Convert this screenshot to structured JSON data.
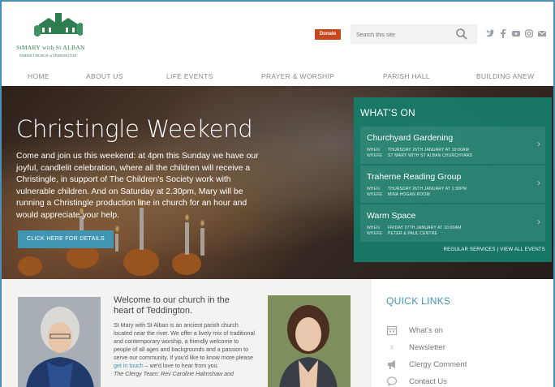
{
  "header": {
    "logo_name": "StMARY with St ALBAN",
    "logo_sub": "PARISH CHURCH of TEDDINGTON",
    "donate_label": "Donate",
    "search_placeholder": "Search this site"
  },
  "socials": [
    "twitter-icon",
    "facebook-icon",
    "youtube-icon",
    "instagram-icon",
    "email-icon"
  ],
  "nav": [
    "HOME",
    "ABOUT US",
    "LIFE EVENTS",
    "PRAYER & WORSHIP",
    "PARISH HALL",
    "BUILDING ANEW"
  ],
  "hero": {
    "title": "Christingle Weekend",
    "text": "Come and join us this weekend: at 4pm this Sunday we have our joyful, candlelit celebration, where all the children will receive a Christingle, in support of The Children's Society work with vulnerable children. And on Saturday at 2.30pm, Mary will be running a Christingle production line in church for an hour and would appreciate your help.",
    "button_label": "CLICK HERE FOR DETAILS"
  },
  "whats_on": {
    "title": "WHAT'S ON",
    "when_label": "WHEN",
    "where_label": "WHERE",
    "events": [
      {
        "title": "Churchyard Gardening",
        "when": "THURSDAY 26TH JANUARY AT 10:00AM",
        "where": "ST MARY WITH ST ALBAN CHURCHYARD"
      },
      {
        "title": "Traherne Reading Group",
        "when": "THURSDAY 26TH JANUARY AT 1:30PM",
        "where": "MINA HOGAN ROOM"
      },
      {
        "title": "Warm Space",
        "when": "FRIDAY 27TH JANUARY AT 10:00AM",
        "where": "PETER & PAUL CENTRE"
      }
    ],
    "links": "REGULAR SERVICES | VIEW ALL EVENTS"
  },
  "welcome": {
    "title": "Welcome to our church in the heart of Teddington.",
    "body": "St Mary with St Alban is an ancient parish church located near the river. We offer a lively mix of traditional and contemporary worship, a friendly welcome to people of all ages and backgrounds and a passion to serve our community. If you'd like to know more please",
    "link": "get in touch",
    "body_end": " – we'd love to hear from you.",
    "signature": "The Clergy Team: Rev Caroline Halmshaw and"
  },
  "quick_links": {
    "title": "QUICK LINKS",
    "items": [
      {
        "icon": "calendar-icon",
        "label": "What's on"
      },
      {
        "icon": "chevron-right-icon",
        "label": "Newsletter"
      },
      {
        "icon": "megaphone-icon",
        "label": "Clergy Comment"
      },
      {
        "icon": "chat-bubble-icon",
        "label": "Contact Us"
      }
    ]
  }
}
